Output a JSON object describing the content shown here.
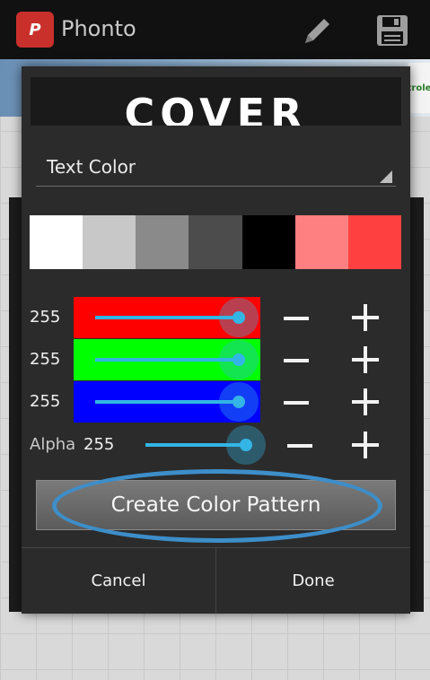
{
  "action_bar": {
    "app_icon_text": "P",
    "title": "Phonto",
    "icons": [
      "pencil-icon",
      "save-icon"
    ]
  },
  "ad": {
    "right_text": "trole"
  },
  "dialog": {
    "preview_text": "COVER",
    "spinner": {
      "selected": "Text Color"
    },
    "swatches": [
      "#ffffff",
      "#c8c8c8",
      "#8a8a8a",
      "#4c4c4c",
      "#000000",
      "#ff8080",
      "#ff4040"
    ],
    "rows": [
      {
        "channel": "red",
        "value": "255",
        "color": "#ff0000",
        "level": 1.0
      },
      {
        "channel": "green",
        "value": "255",
        "color": "#00ff00",
        "level": 1.0
      },
      {
        "channel": "blue",
        "value": "255",
        "color": "#0000ff",
        "level": 1.0
      }
    ],
    "alpha": {
      "label": "Alpha",
      "value": "255",
      "level": 1.0
    },
    "pattern_button": "Create Color Pattern",
    "cancel_button": "Cancel",
    "done_button": "Done",
    "accent_color": "#33b5e5",
    "highlight_color": "#3d8ec9"
  }
}
